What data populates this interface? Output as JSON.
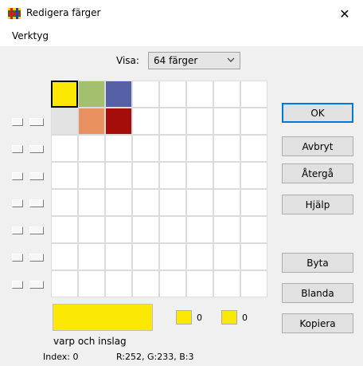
{
  "window": {
    "title": "Redigera färger",
    "close_label": "✕"
  },
  "menu": {
    "items": [
      "Verktyg"
    ]
  },
  "visa": {
    "label": "Visa:",
    "selected": "64 färger"
  },
  "palette": {
    "rows": 8,
    "cols": 8,
    "selected_index": 0,
    "colored_cells": [
      {
        "row": 0,
        "col": 0,
        "color": "#fce903"
      },
      {
        "row": 0,
        "col": 1,
        "color": "#a3c06e"
      },
      {
        "row": 0,
        "col": 2,
        "color": "#5660a6"
      },
      {
        "row": 1,
        "col": 0,
        "color": "#e3e3e3"
      },
      {
        "row": 1,
        "col": 1,
        "color": "#e99260"
      },
      {
        "row": 1,
        "col": 2,
        "color": "#a50d0a"
      }
    ],
    "row_controls_from_row": 1
  },
  "buttons": {
    "ok": "OK",
    "avbryt": "Avbryt",
    "atergaa": "Återgå",
    "hjalp": "Hjälp",
    "byta": "Byta",
    "blanda": "Blanda",
    "kopiera": "Kopiera"
  },
  "current": {
    "color": "#fce903",
    "warp_count": "0",
    "weft_count": "0",
    "description": "varp och inslag"
  },
  "status": {
    "index": "Index: 0",
    "rgb": "R:252, G:233, B:3"
  }
}
